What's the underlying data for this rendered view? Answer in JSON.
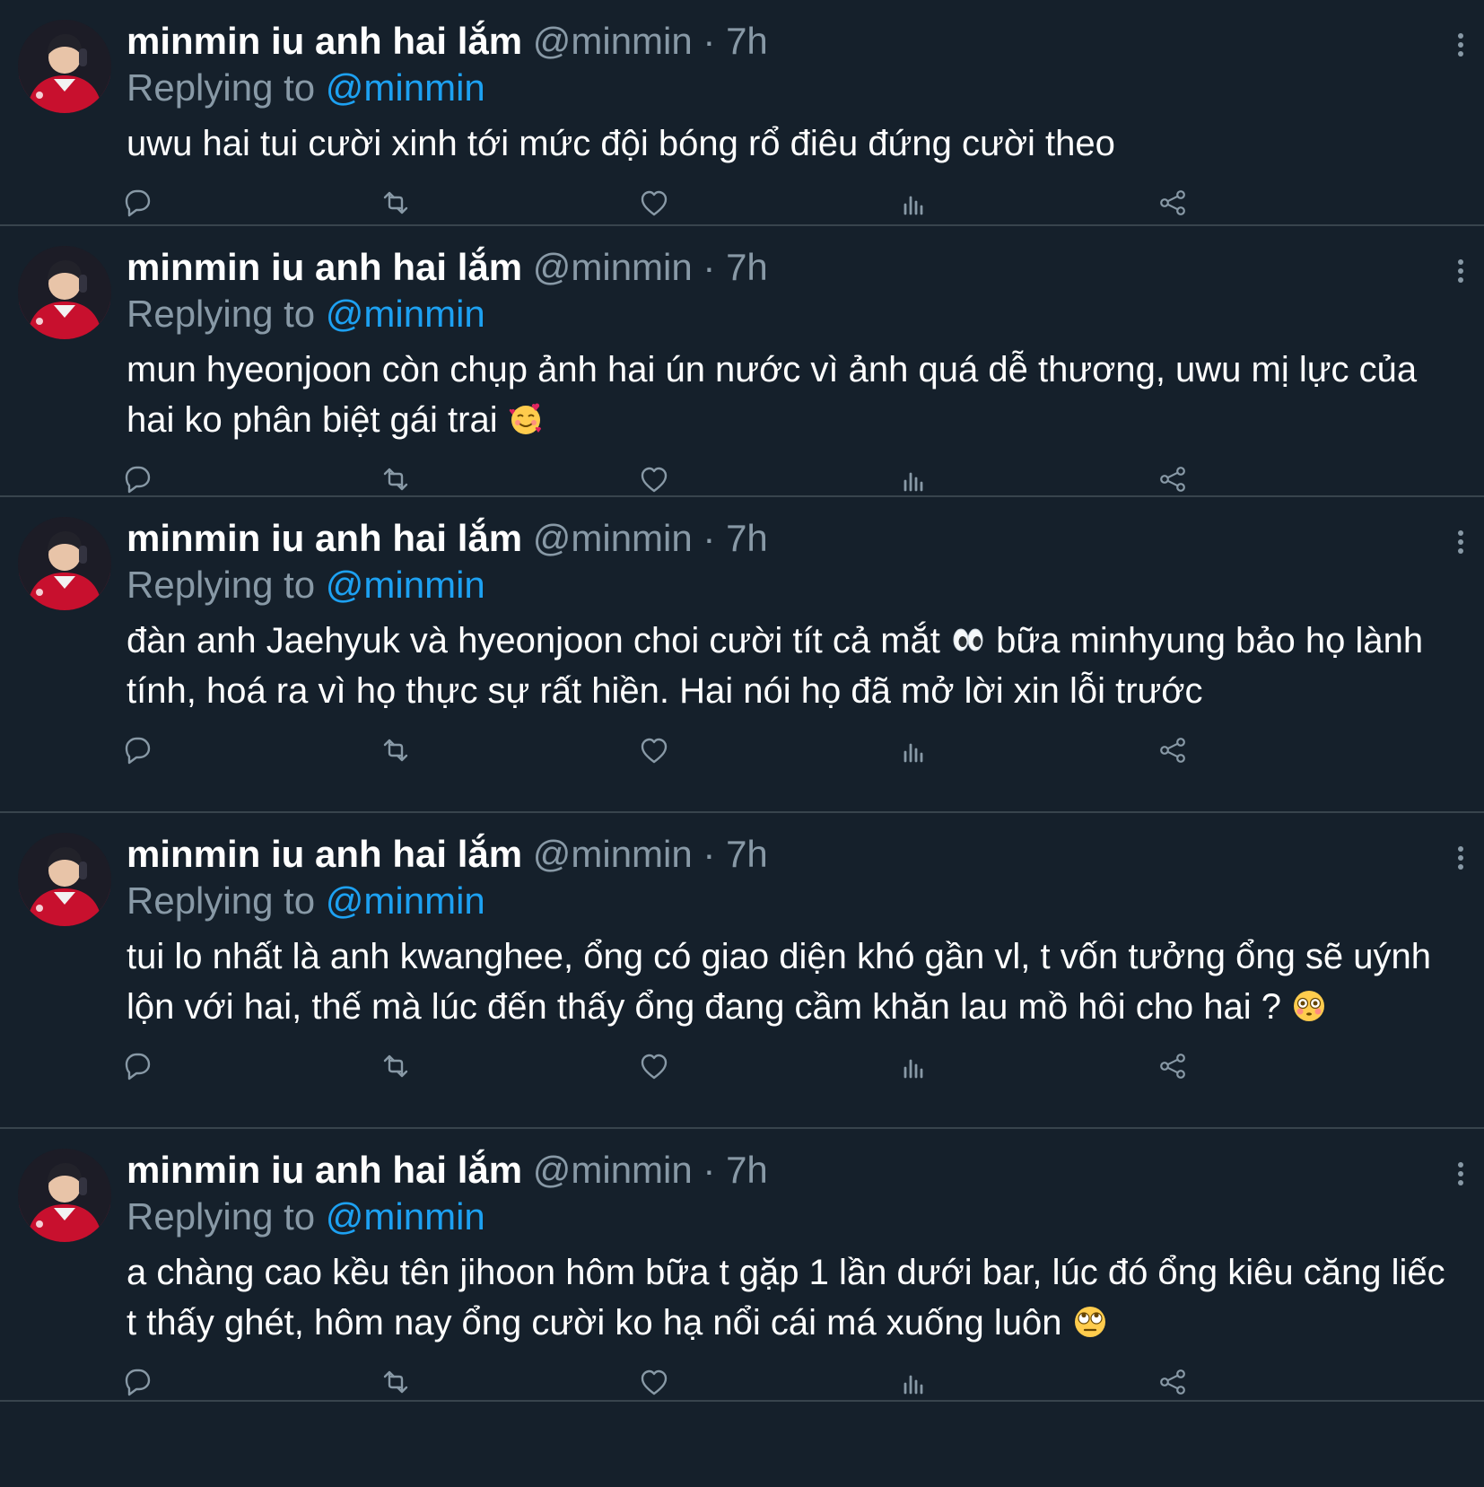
{
  "colors": {
    "background": "#15202b",
    "divider": "#38444d",
    "text": "#ffffff",
    "muted": "#8899a6",
    "link": "#1da1f2"
  },
  "tweets": [
    {
      "name": "minmin iu anh hai lắm",
      "handle": "@minmin",
      "sep": "·",
      "time": "7h",
      "replying_label": "Replying to",
      "replying_to": "@minmin",
      "text": "uwu hai tui cười xinh tới mức đội bóng rổ điêu đứng cười theo",
      "emoji": ""
    },
    {
      "name": "minmin iu anh hai lắm",
      "handle": "@minmin",
      "sep": "·",
      "time": "7h",
      "replying_label": "Replying to",
      "replying_to": "@minmin",
      "text": "mun hyeonjoon còn chụp ảnh hai ún nước vì ảnh quá dễ thương, uwu mị lực của hai ko phân biệt gái trai",
      "emoji": "smiling-face-with-hearts"
    },
    {
      "name": "minmin iu anh hai lắm",
      "handle": "@minmin",
      "sep": "·",
      "time": "7h",
      "replying_label": "Replying to",
      "replying_to": "@minmin",
      "text": "đàn anh Jaehyuk và hyeonjoon choi cười tít cả mắt",
      "text_after": "bữa minhyung bảo họ lành tính, hoá ra vì họ thực sự rất hiền. Hai nói họ đã mở lời xin lỗi trước",
      "emoji": "eyes"
    },
    {
      "name": "minmin iu anh hai lắm",
      "handle": "@minmin",
      "sep": "·",
      "time": "7h",
      "replying_label": "Replying to",
      "replying_to": "@minmin",
      "text": "tui lo nhất là anh kwanghee, ổng có giao diện khó gần vl, t vốn tưởng ổng sẽ uýnh lộn với hai, thế mà lúc đến thấy ổng đang cầm khăn lau mồ hôi cho hai ?",
      "emoji": "flushed-face"
    },
    {
      "name": "minmin iu anh hai lắm",
      "handle": "@minmin",
      "sep": "·",
      "time": "7h",
      "replying_label": "Replying to",
      "replying_to": "@minmin",
      "text": "a chàng cao kều tên jihoon hôm bữa t gặp  1 lần dưới bar, lúc đó ổng kiêu căng liếc t  thấy ghét, hôm nay ổng cười ko hạ nổi cái má xuống luôn",
      "emoji": "face-with-rolling-eyes"
    }
  ],
  "action_icons": [
    "reply-icon",
    "retweet-icon",
    "like-icon",
    "analytics-icon",
    "share-icon"
  ]
}
